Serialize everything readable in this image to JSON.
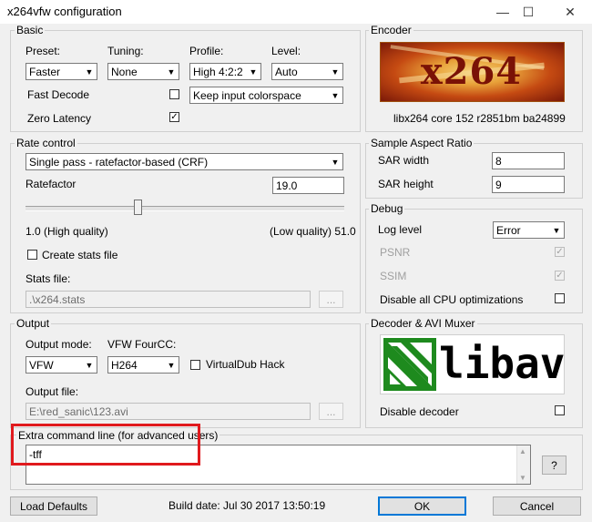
{
  "window": {
    "title": "x264vfw configuration",
    "minimize": "—",
    "maximize": "☐",
    "close": "✕"
  },
  "basic": {
    "label": "Basic",
    "preset_label": "Preset:",
    "preset_value": "Faster",
    "tuning_label": "Tuning:",
    "tuning_value": "None",
    "profile_label": "Profile:",
    "profile_value": "High 4:2:2",
    "level_label": "Level:",
    "level_value": "Auto",
    "fast_decode_label": "Fast Decode",
    "fast_decode_checked": false,
    "colorspace_value": "Keep input colorspace",
    "zero_latency_label": "Zero Latency",
    "zero_latency_checked": true
  },
  "encoder": {
    "label": "Encoder",
    "version": "libx264 core 152 r2851bm ba24899",
    "logo_text": "x264"
  },
  "rate_control": {
    "label": "Rate control",
    "mode_value": "Single pass - ratefactor-based (CRF)",
    "ratefactor_label": "Ratefactor",
    "ratefactor_value": "19.0",
    "slider_min_label": "1.0 (High quality)",
    "slider_max_label": "(Low quality) 51.0",
    "slider_level": 0.35,
    "create_stats_label": "Create stats file",
    "stats_file_label": "Stats file:",
    "stats_file_value": ".\\x264.stats",
    "browse_label": "..."
  },
  "sar": {
    "label": "Sample Aspect Ratio",
    "width_label": "SAR width",
    "width_value": "8",
    "height_label": "SAR height",
    "height_value": "9"
  },
  "debug": {
    "label": "Debug",
    "log_level_label": "Log level",
    "log_level_value": "Error",
    "psnr_label": "PSNR",
    "ssim_label": "SSIM",
    "cpu_opt_label": "Disable all CPU optimizations"
  },
  "output": {
    "label": "Output",
    "mode_label": "Output mode:",
    "mode_value": "VFW",
    "fourcc_label": "VFW FourCC:",
    "fourcc_value": "H264",
    "vdub_hack_label": "VirtualDub Hack",
    "file_label": "Output file:",
    "file_value": "E:\\red_sanic\\123.avi",
    "browse_label": "..."
  },
  "decoder": {
    "label": "Decoder & AVI Muxer",
    "logo_text": "libav",
    "disable_label": "Disable decoder"
  },
  "extra": {
    "label": "Extra command line (for advanced users)",
    "value": "-tff",
    "help_label": "?"
  },
  "footer": {
    "load_defaults": "Load Defaults",
    "build_date": "Build date: Jul 30 2017 13:50:19",
    "ok": "OK",
    "cancel": "Cancel"
  },
  "colors": {
    "highlight_box": "#e0191d",
    "libav_green": "#1e8a1e"
  }
}
